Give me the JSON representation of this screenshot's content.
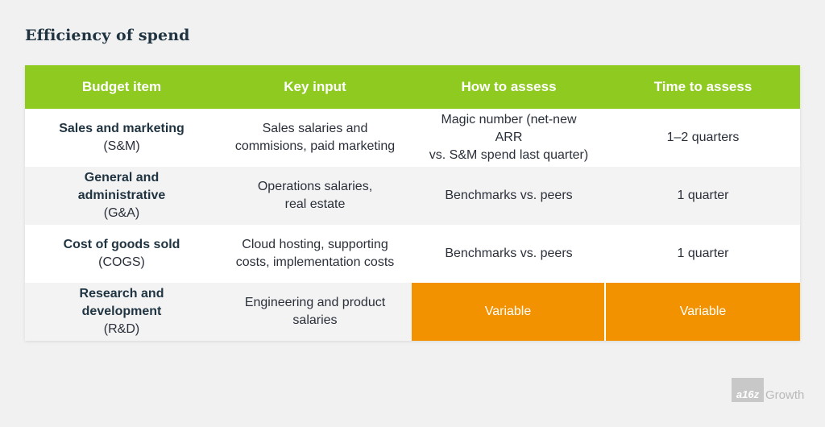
{
  "title": "Efficiency of spend",
  "headers": [
    "Budget item",
    "Key input",
    "How to assess",
    "Time to assess"
  ],
  "rows": [
    {
      "item": "Sales and marketing",
      "abbr": "(S&M)",
      "input_l1": "Sales salaries and",
      "input_l2": "commisions, paid marketing",
      "assess_l1": "Magic number (net-new ARR",
      "assess_l2": "vs. S&M spend last quarter)",
      "time": "1–2 quarters"
    },
    {
      "item": "General and administrative",
      "abbr": "(G&A)",
      "input_l1": "Operations salaries,",
      "input_l2": "real estate",
      "assess": "Benchmarks vs. peers",
      "time": "1 quarter"
    },
    {
      "item": "Cost of goods sold",
      "abbr": "(COGS)",
      "input_l1": "Cloud hosting, supporting",
      "input_l2": "costs, implementation costs",
      "assess": "Benchmarks vs. peers",
      "time": "1 quarter"
    },
    {
      "item": "Research and development",
      "abbr": "(R&D)",
      "input_l1": "Engineering and product",
      "input_l2": "salaries",
      "assess": "Variable",
      "time": "Variable"
    }
  ],
  "colors": {
    "header": "#8fca20",
    "highlight": "#f39200",
    "title": "#1f3340"
  },
  "logo": {
    "mark": "a16z",
    "text": "Growth"
  }
}
